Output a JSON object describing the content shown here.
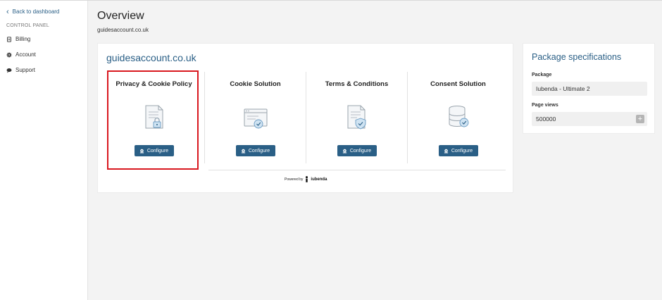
{
  "sidebar": {
    "back_label": "Back to dashboard",
    "section_label": "CONTROL PANEL",
    "items": [
      {
        "label": "Billing",
        "icon": "billing-icon"
      },
      {
        "label": "Account",
        "icon": "gear-icon"
      },
      {
        "label": "Support",
        "icon": "chat-icon"
      }
    ]
  },
  "header": {
    "title": "Overview",
    "subtitle": "guidesaccount.co.uk"
  },
  "site": {
    "title": "guidesaccount.co.uk",
    "products": [
      {
        "title": "Privacy & Cookie Policy",
        "icon": "document-lock-icon",
        "button": "Configure",
        "highlighted": true
      },
      {
        "title": "Cookie Solution",
        "icon": "browser-shield-icon",
        "button": "Configure"
      },
      {
        "title": "Terms & Conditions",
        "icon": "document-shield-icon",
        "button": "Configure"
      },
      {
        "title": "Consent Solution",
        "icon": "database-shield-icon",
        "button": "Configure"
      }
    ],
    "powered_by": "Powered by",
    "brand": "iubenda"
  },
  "package": {
    "title": "Package specifications",
    "package_label": "Package",
    "package_value": "Iubenda - Ultimate 2",
    "pageviews_label": "Page views",
    "pageviews_value": "500000"
  },
  "colors": {
    "accent": "#2a5f86",
    "highlight": "#d9181f",
    "background": "#f3f3f3"
  }
}
